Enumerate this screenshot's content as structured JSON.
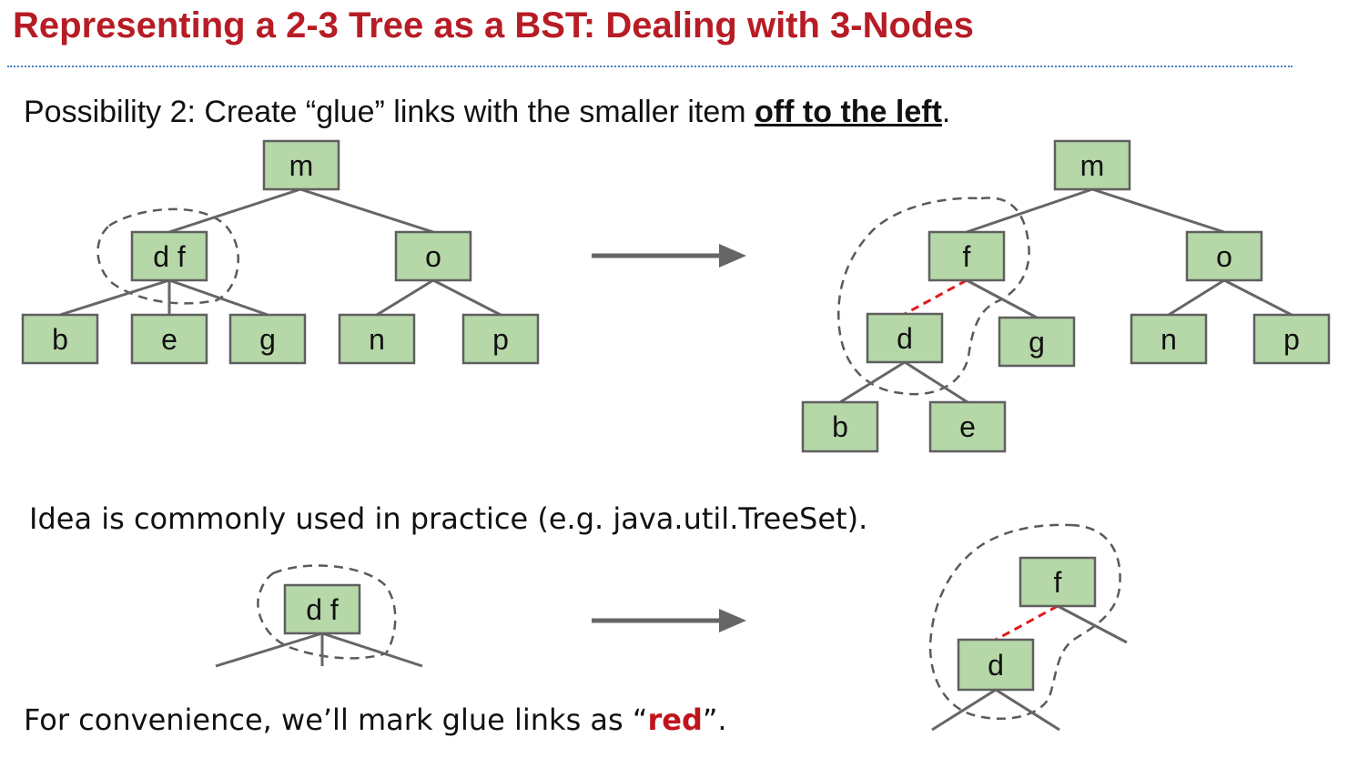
{
  "title": "Representing a 2-3 Tree as a BST: Dealing with 3-Nodes",
  "possibility": {
    "prefix": "Possibility 2: Create “glue” links with the smaller item ",
    "emphasis": "off to the left",
    "suffix": "."
  },
  "idea_text": "Idea is commonly used in practice (e.g. java.util.TreeSet).",
  "convenience": {
    "prefix": "For convenience, we’ll mark glue links as “",
    "red_word": "red",
    "suffix": "”."
  },
  "colors": {
    "title": "#b71c25",
    "node_fill": "#b6d7a8",
    "glue_link": "#e01b1b"
  },
  "tree_23": {
    "root": "m",
    "three_node": "d f",
    "right_child": "o",
    "leaves": [
      "b",
      "e",
      "g",
      "n",
      "p"
    ]
  },
  "tree_bst": {
    "root": "m",
    "glued_parent": "f",
    "glued_child": "d",
    "right_child": "o",
    "leaves": [
      "g",
      "n",
      "p",
      "b",
      "e"
    ]
  },
  "small_23": {
    "three_node": "d f"
  },
  "small_bst": {
    "parent": "f",
    "child": "d"
  }
}
